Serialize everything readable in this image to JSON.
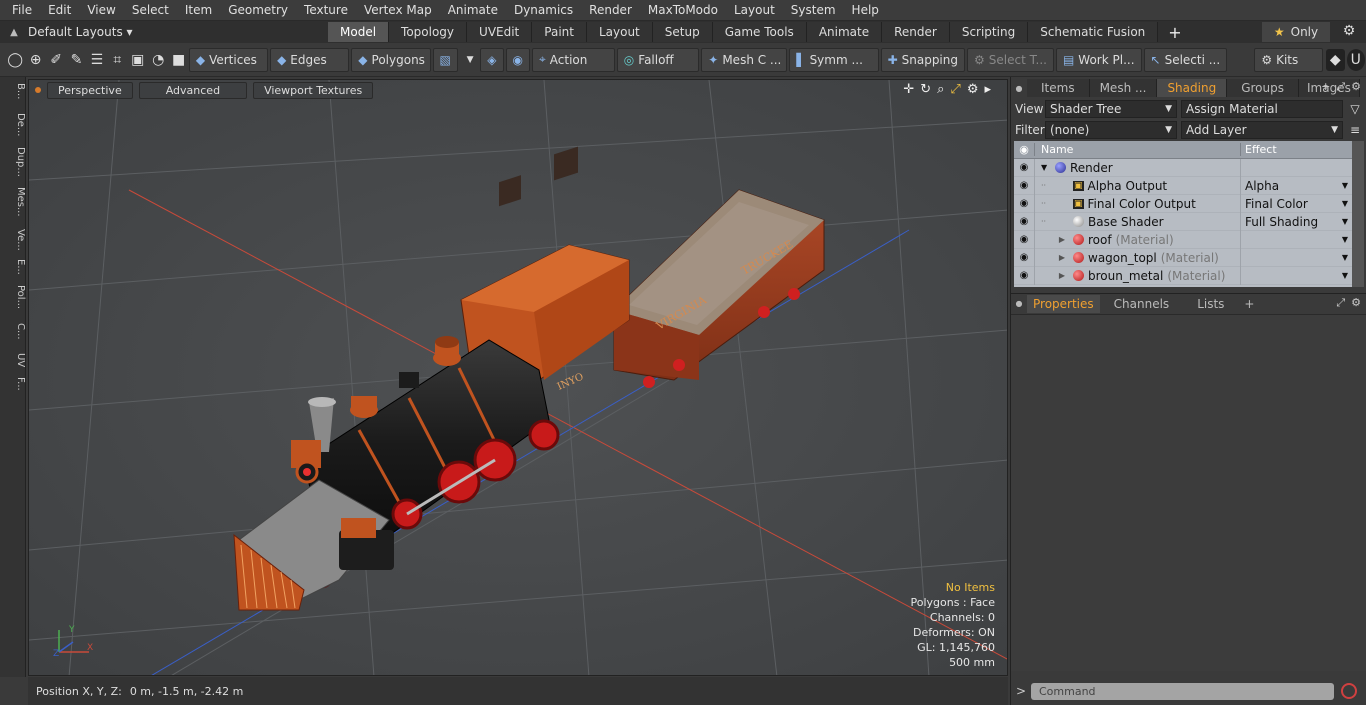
{
  "menu": [
    "File",
    "Edit",
    "View",
    "Select",
    "Item",
    "Geometry",
    "Texture",
    "Vertex Map",
    "Animate",
    "Dynamics",
    "Render",
    "MaxToModo",
    "Layout",
    "System",
    "Help"
  ],
  "layout_selector": "Default Layouts ▾",
  "layout_tabs": [
    "Model",
    "Topology",
    "UVEdit",
    "Paint",
    "Layout",
    "Setup",
    "Game Tools",
    "Animate",
    "Render",
    "Scripting",
    "Schematic Fusion"
  ],
  "active_layout_tab": "Model",
  "only_label": "Only",
  "toolbar": {
    "vertices": "Vertices",
    "edges": "Edges",
    "polygons": "Polygons",
    "action": "Action",
    "falloff": "Falloff",
    "mesh": "Mesh C ...",
    "symm": "Symm ...",
    "snapping": "Snapping",
    "select_t": "Select T...",
    "work_pl": "Work Pl...",
    "selecti": "Selecti ...",
    "kits": "Kits"
  },
  "left_strip": [
    "B...",
    "De...",
    "Dup...",
    "Mes...",
    "Ve...",
    "E...",
    "Pol...",
    "C...",
    "UV",
    "F..."
  ],
  "viewport": {
    "view_mode": "Perspective",
    "advanced": "Advanced",
    "textures": "Viewport Textures",
    "info": {
      "items": "No Items",
      "polygons": "Polygons : Face",
      "channels": "Channels: 0",
      "deformers": "Deformers: ON",
      "gl": "GL: 1,145,760",
      "scale": "500 mm"
    }
  },
  "status": {
    "label": "Position X, Y, Z:",
    "value": "0 m, -1.5 m, -2.42 m"
  },
  "right_panel": {
    "tabs": [
      "Items",
      "Mesh ...",
      "Shading",
      "Groups",
      "Images"
    ],
    "active_tab": "Shading",
    "view_label": "View",
    "view_value": "Shader Tree",
    "assign_material": "Assign Material",
    "filter_label": "Filter",
    "filter_value": "(none)",
    "add_layer": "Add Layer",
    "tree_header": {
      "name": "Name",
      "effect": "Effect"
    },
    "tree_rows": [
      {
        "name": "Render",
        "effect": "",
        "sub": "",
        "icon": "render-ball-icon"
      },
      {
        "name": "Alpha Output",
        "effect": "Alpha",
        "sub": "",
        "icon": "output-icon"
      },
      {
        "name": "Final Color Output",
        "effect": "Final Color",
        "sub": "",
        "icon": "output-icon"
      },
      {
        "name": "Base Shader",
        "effect": "Full Shading",
        "sub": "",
        "icon": "shader-ball-icon"
      },
      {
        "name": "roof",
        "effect": "",
        "sub": "(Material)",
        "icon": "material-icon"
      },
      {
        "name": "wagon_topl",
        "effect": "",
        "sub": "(Material)",
        "icon": "material-icon"
      },
      {
        "name": "broun_metal",
        "effect": "",
        "sub": "(Material)",
        "icon": "material-icon"
      }
    ],
    "prop_tabs": [
      "Properties",
      "Channels",
      "Lists"
    ],
    "active_prop_tab": "Properties",
    "command_placeholder": "Command"
  },
  "colors": {
    "accent_orange": "#f0a030",
    "viewport_bg": "#47494b",
    "info_warn": "#f0c040"
  }
}
